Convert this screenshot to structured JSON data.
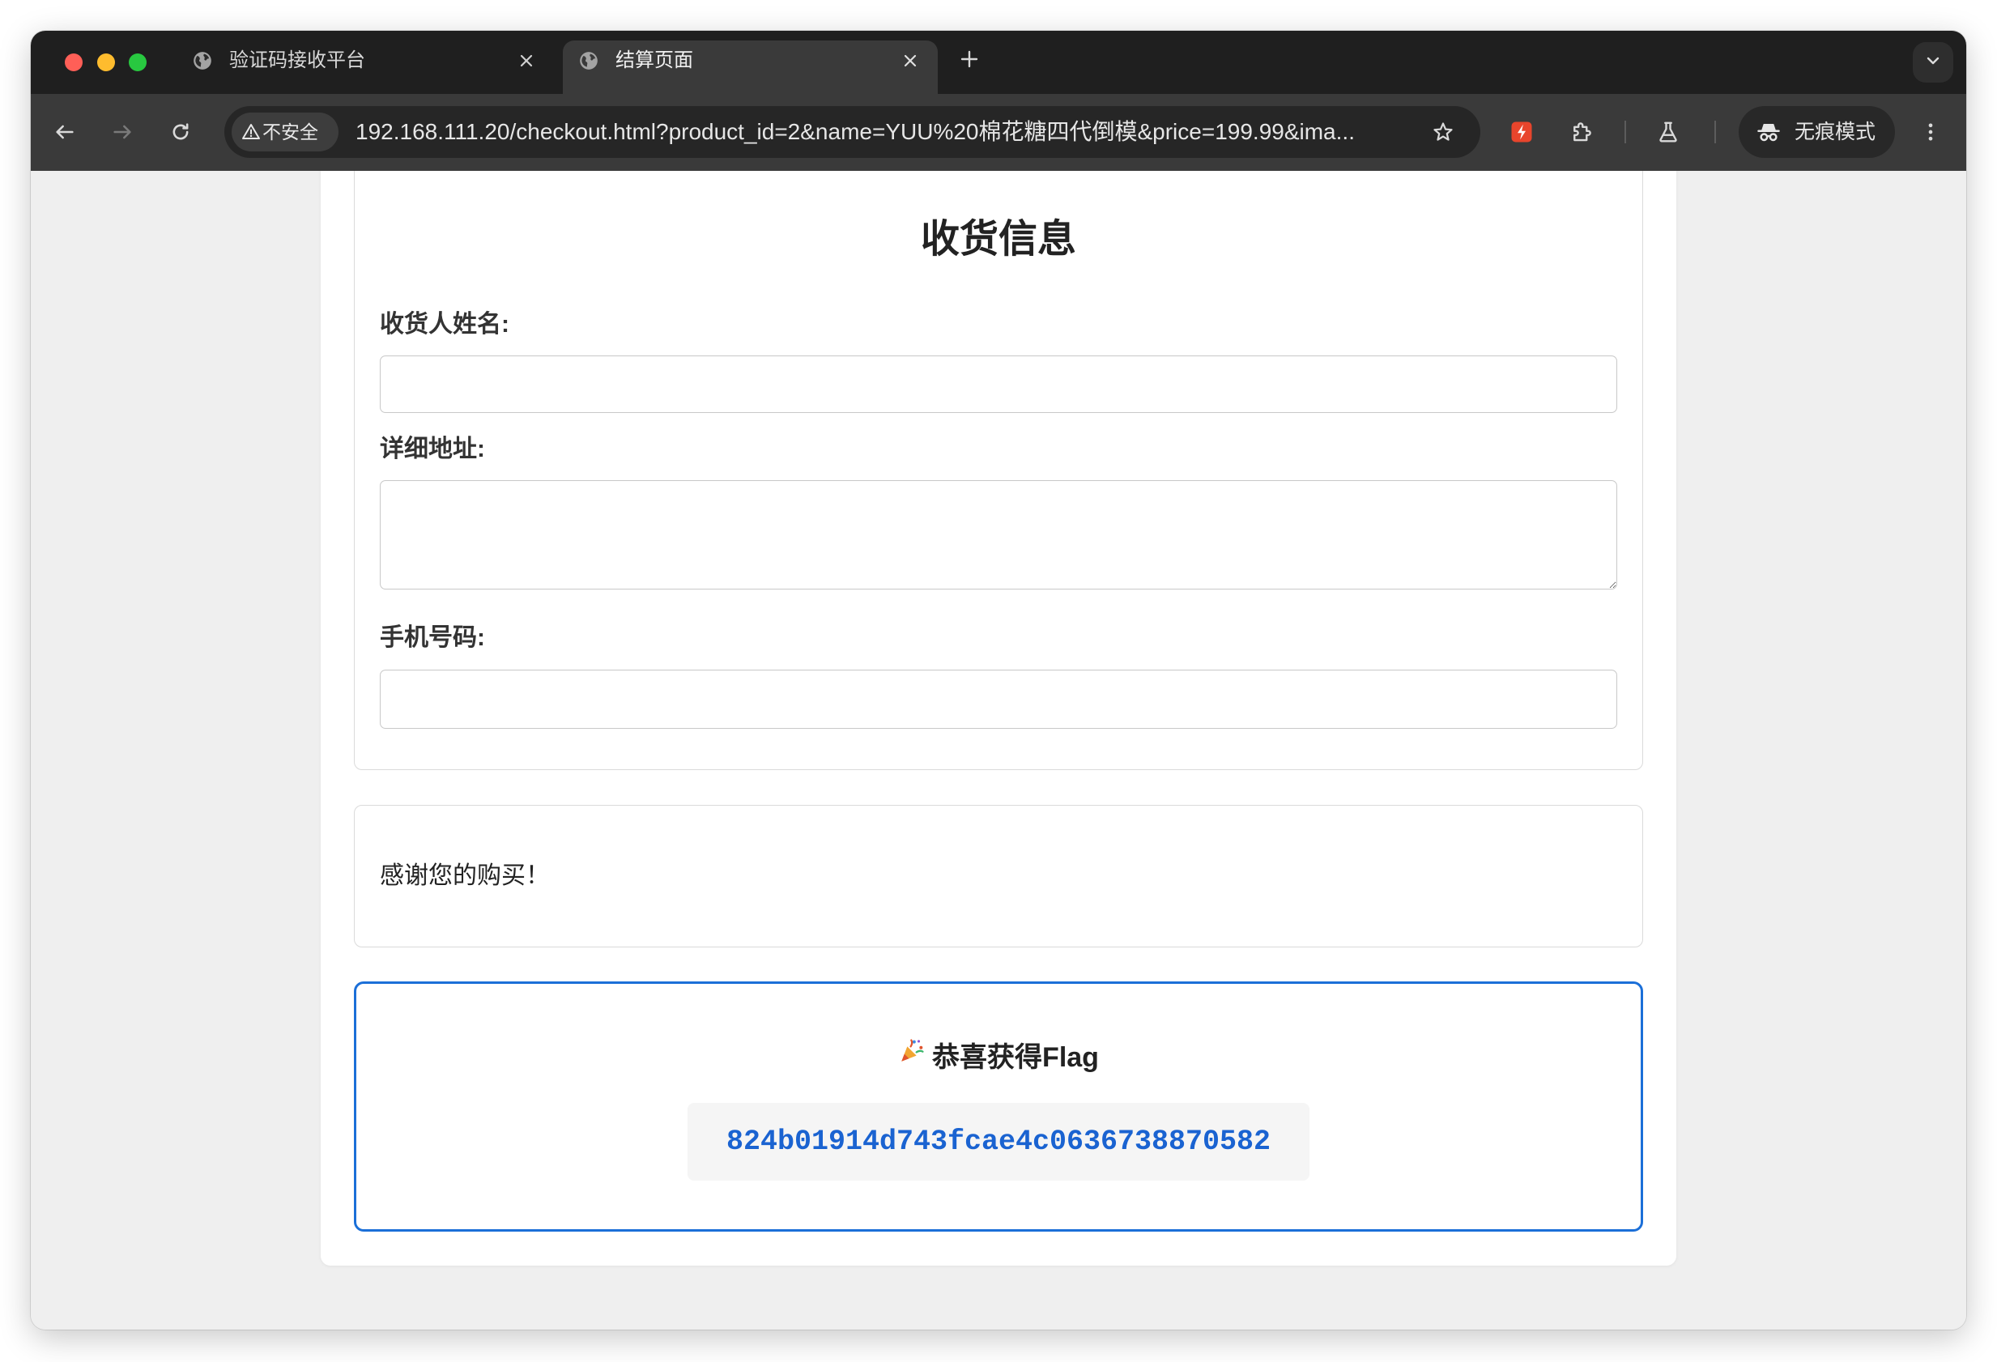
{
  "browser": {
    "window_controls": {
      "close_color": "#ff5f57",
      "minimize_color": "#febc2e",
      "zoom_color": "#28c840"
    },
    "tabs": [
      {
        "title": "验证码接收平台",
        "icon": "globe-icon",
        "active": false
      },
      {
        "title": "结算页面",
        "icon": "globe-icon",
        "active": true
      }
    ],
    "address_bar": {
      "security_label": "不安全",
      "url": "192.168.111.20/checkout.html?product_id=2&name=YUU%20棉花糖四代倒模&price=199.99&ima..."
    },
    "toolbar_icons": [
      "back-arrow-icon",
      "forward-arrow-icon",
      "reload-icon",
      "bookmark-star-icon",
      "extension-icon",
      "puzzle-icon",
      "labs-flask-icon",
      "incognito-icon",
      "more-menu-icon"
    ],
    "incognito_label": "无痕模式",
    "theme": {
      "frame": "#1f1f1f",
      "toolbar": "#3a3a3a",
      "omnibox": "#262626"
    }
  },
  "page": {
    "shipping_form": {
      "title": "收货信息",
      "fields": [
        {
          "label": "收货人姓名:",
          "value": ""
        },
        {
          "label": "详细地址:",
          "value": ""
        },
        {
          "label": "手机号码:",
          "value": ""
        }
      ]
    },
    "thank_you": {
      "message": "感谢您的购买！"
    },
    "flag_panel": {
      "icon": "party-popper-icon",
      "title": "恭喜获得Flag",
      "flag": "824b01914d743fcae4c0636738870582"
    },
    "colors": {
      "background": "#efefef",
      "accent_border": "#1b6fd8",
      "flag_text": "#1a63d1",
      "code_bg": "#f5f5f5"
    }
  }
}
